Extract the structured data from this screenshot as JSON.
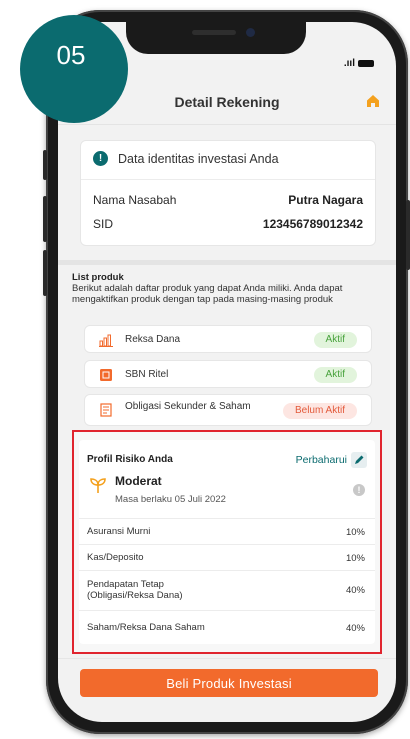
{
  "step_badge": "05",
  "status_bar": {
    "signal": ".ııl"
  },
  "header": {
    "title": "Detail Rekening"
  },
  "identity": {
    "notice": "Data identitas investasi Anda",
    "rows": [
      {
        "label": "Nama Nasabah",
        "value": "Putra Nagara"
      },
      {
        "label": "SID",
        "value": "123456789012342"
      }
    ]
  },
  "products": {
    "title": "List produk",
    "description": "Berikut adalah daftar produk yang dapat Anda miliki. Anda dapat mengaktifkan produk dengan tap pada masing-masing produk",
    "items": [
      {
        "name": "Reksa Dana",
        "status": "Aktif",
        "icon": "bar-chart-icon"
      },
      {
        "name": "SBN Ritel",
        "status": "Aktif",
        "icon": "sbn-icon"
      },
      {
        "name": "Obligasi Sekunder & Saham",
        "status": "Belum Aktif",
        "icon": "document-icon"
      }
    ]
  },
  "risk_profile": {
    "title": "Profil Risiko Anda",
    "update_label": "Perbaharui",
    "profile": "Moderat",
    "valid_until": "Masa berlaku 05 Juli 2022",
    "allocations": [
      {
        "label": "Asuransi Murni",
        "value": "10%"
      },
      {
        "label": "Kas/Deposito",
        "value": "10%"
      },
      {
        "label": "Pendapatan Tetap\n(Obligasi/Reksa Dana)",
        "value": "40%"
      },
      {
        "label": "Saham/Reksa Dana Saham",
        "value": "40%"
      }
    ]
  },
  "cta": {
    "label": "Beli Produk Investasi"
  },
  "colors": {
    "brand_teal": "#0b6b6f",
    "cta_orange": "#f26a2c",
    "highlight_red": "#e0242e",
    "active_green": "#48a23c",
    "inactive_red": "#e35a3b"
  }
}
